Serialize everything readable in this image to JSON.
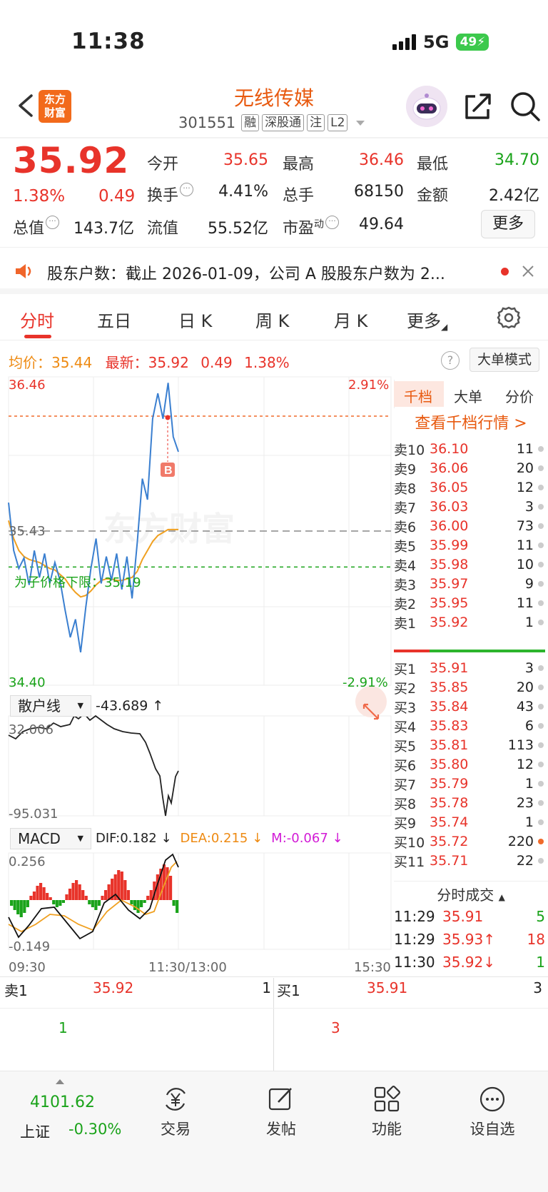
{
  "status_bar": {
    "time": "11:38",
    "network": "5G",
    "battery": "49"
  },
  "header": {
    "logo_text": "东方\n财富",
    "title": "无线传媒",
    "code": "301551",
    "tags": [
      "融",
      "深股通",
      "注",
      "L2"
    ]
  },
  "quote": {
    "price": "35.92",
    "change_pct": "1.38%",
    "change": "0.49",
    "fields": [
      {
        "label": "今开",
        "value": "35.65",
        "color": "red"
      },
      {
        "label": "最高",
        "value": "36.46",
        "color": "red"
      },
      {
        "label": "最低",
        "value": "34.70",
        "color": "green"
      },
      {
        "label": "换手",
        "value": "4.41%",
        "color": "dark"
      },
      {
        "label": "总手",
        "value": "68150",
        "color": "dark"
      },
      {
        "label": "金额",
        "value": "2.42亿",
        "color": "dark"
      },
      {
        "label": "总值",
        "value": "143.7亿",
        "color": "dark"
      },
      {
        "label": "流值",
        "value": "55.52亿",
        "color": "dark"
      },
      {
        "label": "市盈",
        "value": "49.64",
        "color": "dark"
      }
    ],
    "pe_sup": "动",
    "more_label": "更多"
  },
  "news": {
    "text": "股东户数：截止 2026-01-09，公司 A 股股东户数为 2..."
  },
  "tabs": [
    "分时",
    "五日",
    "日 K",
    "周 K",
    "月 K",
    "更多"
  ],
  "info_line": {
    "avg_label": "均价：",
    "avg_value": "35.44",
    "latest_label": "最新：",
    "latest_value": "35.92",
    "change": "0.49",
    "change_pct": "1.38%",
    "big_mode": "大单模式",
    "help": "?"
  },
  "chart_labels": {
    "top_price": "36.46",
    "top_pct": "2.91%",
    "mid_price": "35.43",
    "bottom_price": "34.40",
    "bottom_pct": "-2.91%",
    "watermark": "东方财富",
    "limit_label": "为子价格下限：35.19",
    "retail_selector": "散户线",
    "retail_value": "-43.689 ↑",
    "retail_top": "32.006",
    "retail_bottom": "-95.031",
    "macd_selector": "MACD",
    "dif": "DIF:0.182 ↓",
    "dea": "DEA:0.215 ↓",
    "m": "M:-0.067 ↓",
    "macd_top": "0.256",
    "macd_bottom": "-0.149",
    "time_start": "09:30",
    "time_mid": "11:30/13:00",
    "time_end": "15:30",
    "b_marker": "B"
  },
  "chart_data": {
    "type": "line",
    "x_range": [
      "09:30",
      "15:30"
    ],
    "ylim": [
      34.4,
      36.46
    ],
    "reference_price": 35.43,
    "limit_down_line": 35.19,
    "series": [
      {
        "values": [
          35.62,
          35.3,
          35.18,
          35.25,
          35.07,
          35.3,
          35.12,
          35.28,
          35.08,
          35.22,
          35.1,
          34.9,
          34.72,
          34.84,
          34.62,
          34.92,
          35.18,
          35.38,
          35.08,
          35.26,
          35.1,
          35.28,
          35.04,
          35.26,
          34.98,
          35.35,
          35.78,
          35.64,
          36.18,
          36.35,
          36.18,
          36.42,
          36.06,
          35.96
        ]
      },
      {
        "name": "均价",
        "values": [
          35.5,
          35.38,
          35.3,
          35.26,
          35.24,
          35.23,
          35.22,
          35.2,
          35.18,
          35.17,
          35.14,
          35.11,
          35.06,
          35.02,
          34.99,
          35.0,
          35.03,
          35.07,
          35.1,
          35.11,
          35.11,
          35.1,
          35.1,
          35.11,
          35.12,
          35.16,
          35.24,
          35.3,
          35.36,
          35.4,
          35.42,
          35.44,
          35.44,
          35.44
        ]
      }
    ]
  },
  "order_book": {
    "tabs": [
      "千档",
      "大单",
      "分价"
    ],
    "head_link": "查看千档行情 >",
    "asks": [
      {
        "name": "卖10",
        "price": "36.10",
        "vol": "11"
      },
      {
        "name": "卖9",
        "price": "36.06",
        "vol": "20"
      },
      {
        "name": "卖8",
        "price": "36.05",
        "vol": "12"
      },
      {
        "name": "卖7",
        "price": "36.03",
        "vol": "3"
      },
      {
        "name": "卖6",
        "price": "36.00",
        "vol": "73"
      },
      {
        "name": "卖5",
        "price": "35.99",
        "vol": "11"
      },
      {
        "name": "卖4",
        "price": "35.98",
        "vol": "10"
      },
      {
        "name": "卖3",
        "price": "35.97",
        "vol": "9"
      },
      {
        "name": "卖2",
        "price": "35.95",
        "vol": "11"
      },
      {
        "name": "卖1",
        "price": "35.92",
        "vol": "1"
      }
    ],
    "bids": [
      {
        "name": "买1",
        "price": "35.91",
        "vol": "3"
      },
      {
        "name": "买2",
        "price": "35.85",
        "vol": "20"
      },
      {
        "name": "买3",
        "price": "35.84",
        "vol": "43"
      },
      {
        "name": "买4",
        "price": "35.83",
        "vol": "6"
      },
      {
        "name": "买5",
        "price": "35.81",
        "vol": "113"
      },
      {
        "name": "买6",
        "price": "35.80",
        "vol": "12"
      },
      {
        "name": "买7",
        "price": "35.79",
        "vol": "1"
      },
      {
        "name": "买8",
        "price": "35.78",
        "vol": "23"
      },
      {
        "name": "买9",
        "price": "35.74",
        "vol": "1"
      },
      {
        "name": "买10",
        "price": "35.72",
        "vol": "220"
      },
      {
        "name": "买11",
        "price": "35.71",
        "vol": "22"
      }
    ],
    "trades_title": "分时成交",
    "trades": [
      {
        "time": "11:29",
        "price": "35.91",
        "vol": "5",
        "vol_color": "green"
      },
      {
        "time": "11:29",
        "price": "35.93↑",
        "vol": "18",
        "vol_color": "red"
      },
      {
        "time": "11:30",
        "price": "35.92↓",
        "vol": "1",
        "vol_color": "green"
      }
    ]
  },
  "bottom_quote": {
    "ask_label": "卖1",
    "ask_price": "35.92",
    "ask_vol": "1",
    "ask_queue": "1",
    "bid_label": "买1",
    "bid_price": "35.91",
    "bid_vol": "3",
    "bid_queue": "3"
  },
  "bottom_nav": {
    "index_value": "4101.62",
    "index_name": "上证",
    "index_change": "-0.30%",
    "items": [
      "交易",
      "发帖",
      "功能",
      "设自选"
    ]
  }
}
